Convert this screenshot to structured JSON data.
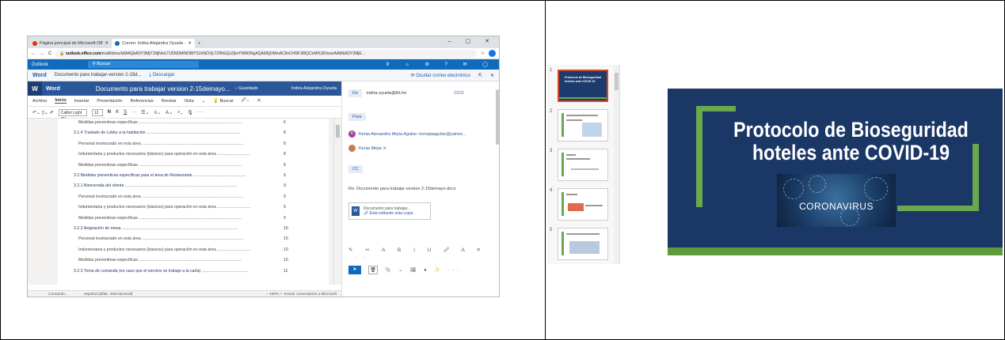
{
  "left": {
    "browser": {
      "tabs": [
        "Página principal de Microsoft Off",
        "Correo: Indira Alejandra Oyuela ·"
      ],
      "window_controls": "–  ▢  ✕",
      "url_host": "outlook.office.com",
      "url_rest": "/mail/inbox/id/AAQkADY3MjY1NjNmLTU5NDMtNDBlYS1hNDVjLTZlNGQzZjIwYWM2NgAQAEBjOMmAC8xOr99F38IQCeM%3D/sxs/AAMkADY2MjE..."
    },
    "outlook": {
      "brand": "Outlook",
      "search": "Buscar",
      "icons": "⚲ ☼ ⚙ ? ✉ ◯"
    },
    "docbar": {
      "app": "Word",
      "file": "Documento para trabajar-version 2-15d...",
      "download": "⤓ Descargar",
      "hide_mail": "✉ Ocultar correo electrónico",
      "popout": "⇱",
      "close": "✕"
    },
    "word": {
      "app": "Word",
      "title": "Documento para trabajar version 2-15demayo...",
      "saved": "–  Guardado",
      "user": "Indira Alejandra Oyuela",
      "ribbon_tabs": [
        "Archivo",
        "Inicio",
        "Insertar",
        "Presentación",
        "Referencias",
        "Revisar",
        "Vista",
        "⌄",
        "💡 Buscar",
        "🖉⌄",
        "⇱"
      ],
      "font": "Calibri Light (Tí...",
      "size": "12",
      "format_buttons": [
        "N",
        "K",
        "S",
        "···",
        "☰⌄",
        "≡⌄",
        "A⌄",
        "⌕⌄",
        "🎙",
        "···"
      ],
      "undo": "↶⌄ ▯⌄ ✐",
      "toc": [
        {
          "text": "Medidas preventivas específicas ..........................................................................................",
          "num": "6",
          "lvl": "lvl2"
        },
        {
          "text": "3.1.4 Traslado de Lobby a la habitación ..................................................................................",
          "num": "8",
          "lvl": "lvl1"
        },
        {
          "text": "Personal involucrado en esta área .........................................................................................",
          "num": "8",
          "lvl": "lvl2"
        },
        {
          "text": "Indumentaria y productos necesarios (básicos) para operación en esta área .............................",
          "num": "8",
          "lvl": "lvl2"
        },
        {
          "text": "Medidas preventivas específicas ..........................................................................................",
          "num": "8",
          "lvl": "lvl2"
        },
        {
          "text": "3.2 Medidas preventivas específicas para el área de Restaurante ..............................................",
          "num": "9",
          "lvl": "lvl1"
        },
        {
          "text": "3.2.1 Bienvenida del cliente ..................................................................................................",
          "num": "9",
          "lvl": "lvl1"
        },
        {
          "text": "Personal involucrado en esta área .........................................................................................",
          "num": "9",
          "lvl": "lvl2"
        },
        {
          "text": "Indumentaria y productos necesarios (básicos) para operación en esta área .............................",
          "num": "9",
          "lvl": "lvl2"
        },
        {
          "text": "Medidas preventivas específicas ..........................................................................................",
          "num": "9",
          "lvl": "lvl2"
        },
        {
          "text": "3.2.2 Asignación de mesa ......................................................................................................",
          "num": "10",
          "lvl": "lvl1"
        },
        {
          "text": "Personal involucrado en esta área .........................................................................................",
          "num": "10",
          "lvl": "lvl2"
        },
        {
          "text": "Indumentaria y productos necesarios (básicos) para operación en esta área .............................",
          "num": "10",
          "lvl": "lvl2"
        },
        {
          "text": "Medidas preventivas específicas ..........................................................................................",
          "num": "10",
          "lvl": "lvl2"
        },
        {
          "text": "3.2.3 Toma de comanda (en caso que el servicio se trabaje a la carta) .........................................",
          "num": "11",
          "lvl": "lvl1"
        }
      ],
      "status_left": "Contando...",
      "status_lang": "español (alfab. internacional)",
      "status_zoom": "–  100%  +",
      "status_feedback": "Enviar comentarios a Microsoft"
    },
    "mail": {
      "from_label": "De",
      "from": "indira.oyuela@iht.hn",
      "cco": "CCO",
      "to_label": "Para",
      "recipients": [
        {
          "name": "Kenia Alexandra Mejía Aguilar <kmejiaaguilar@yahoo...",
          "initial": "K"
        },
        {
          "name": "Kenia Mejia  ✕",
          "initial": ""
        }
      ],
      "cc_label": "CC",
      "subject": "Re: Documento para trabajar-version 2-15demayo.docx",
      "attachment_name": "Documento para trabajar...",
      "attachment_sub": "🔗 Está editando esta copia",
      "format_icons": "✎ ✂ A B I U 🖉 A ≡ ···",
      "send_icon": "➤",
      "discard_icon": "🗑",
      "send_extra": "📎 ⌄ 🖼 ● ✨ ···"
    }
  },
  "right": {
    "slides": [
      1,
      2,
      3,
      4,
      5
    ],
    "thumb1_title": "Protocolo de Bioseguridad hoteles ante COVID 19",
    "title": "Protocolo de Bioseguridad hoteles ante COVID-19",
    "image_caption": "CORONAVIRUS",
    "colors": {
      "slide_bg": "#1b3766",
      "accent_green": "#6aa84f",
      "selected_thumb": "#d24726"
    }
  }
}
